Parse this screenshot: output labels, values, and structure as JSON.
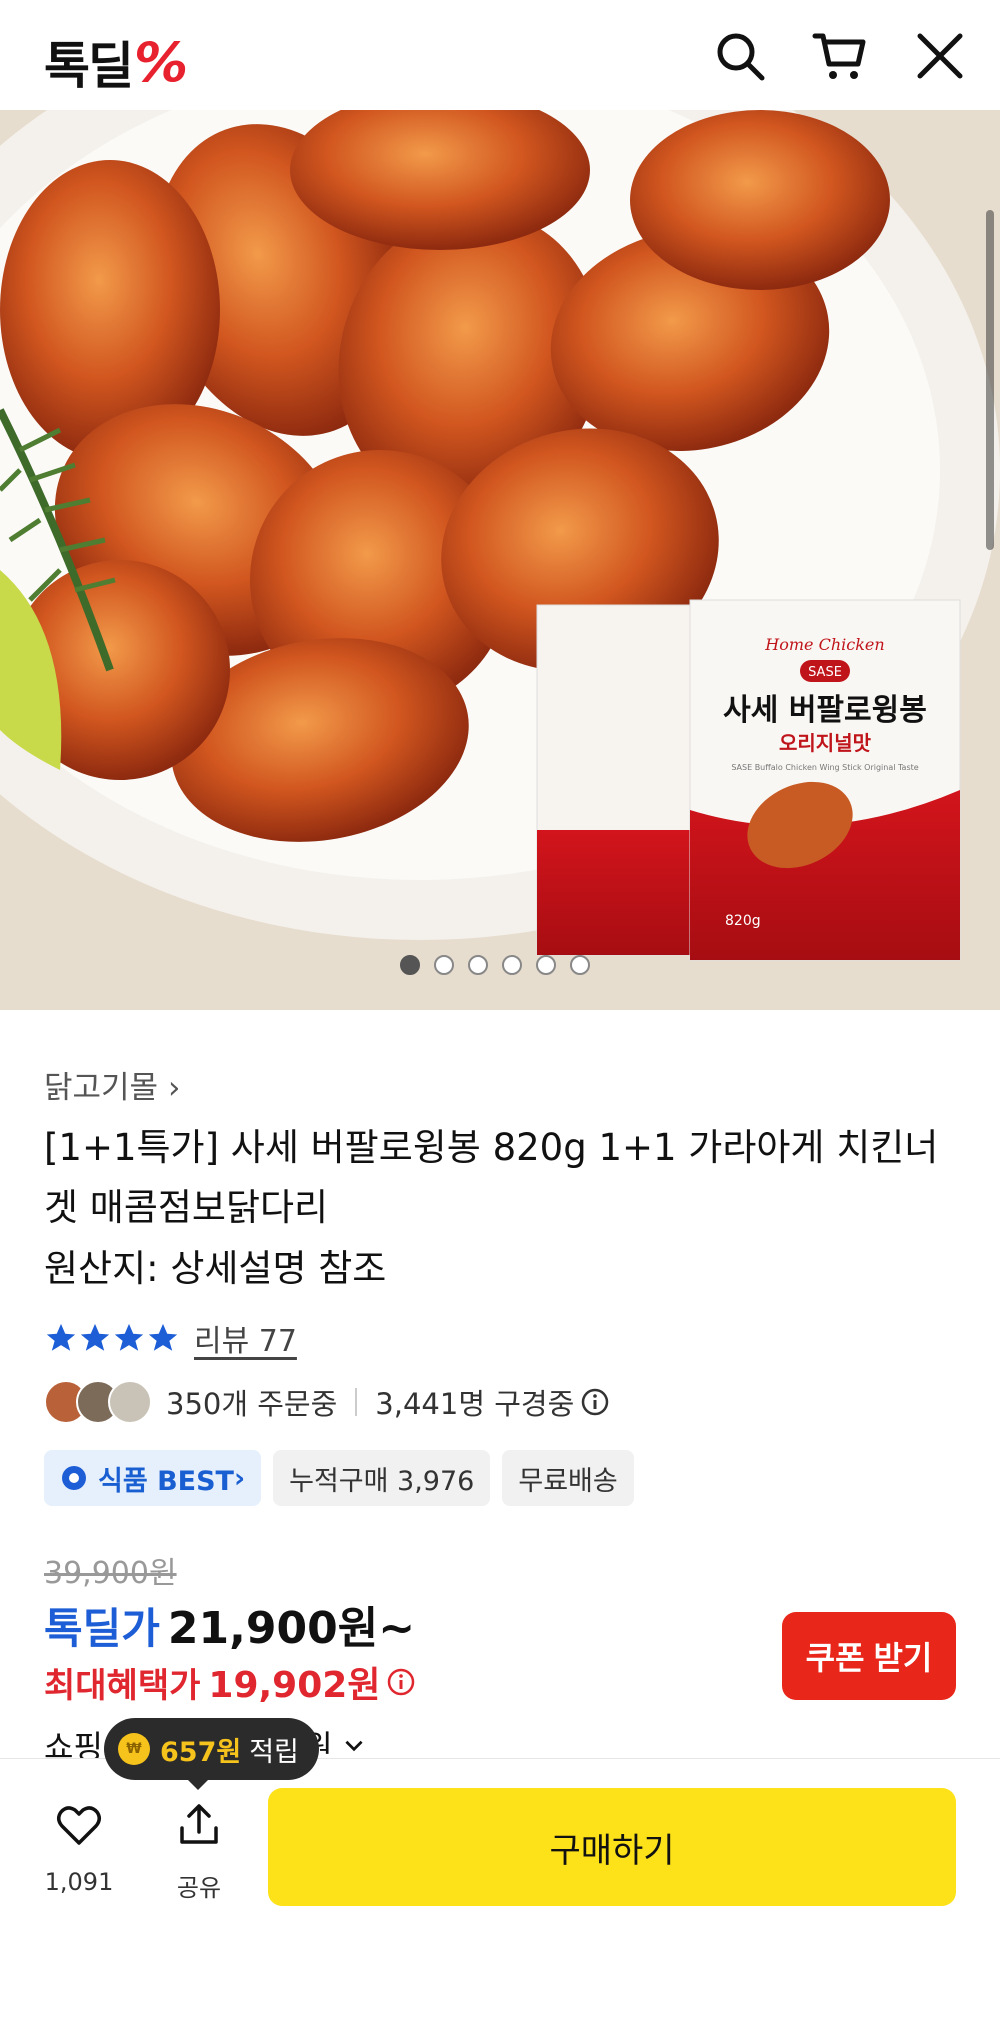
{
  "header": {
    "logo_text": "톡딜",
    "logo_mark": "%",
    "icons": [
      "search-icon",
      "cart-icon",
      "close-icon"
    ]
  },
  "hero": {
    "package_brand": "Home Chicken",
    "package_badge": "SASE",
    "package_title": "사세 버팔로윙봉",
    "package_subtitle": "오리지널맛",
    "package_english": "SASE Buffalo Chicken Wing Stick Original Taste",
    "package_weight": "820g",
    "carousel_total": 6,
    "carousel_active": 1
  },
  "product": {
    "breadcrumb": "닭고기몰",
    "title": "[1+1특가] 사세 버팔로윙봉 820g 1+1 가라아게 치킨너겟 매콤점보닭다리",
    "origin": "원산지: 상세설명 참조",
    "rating_stars": 4,
    "review_label": "리뷰 77",
    "ordering": "350개 주문중",
    "watching": "3,441명 구경중"
  },
  "tags": {
    "best": "식품 BEST",
    "cumulative": "누적구매 3,976",
    "shipping": "무료배송"
  },
  "pricing": {
    "original": "39,900원",
    "deal_label": "톡딜가",
    "deal_price": "21,900원~",
    "max_benefit_label": "최대혜택가",
    "max_benefit_price": "19,902원",
    "coupon_button": "쿠폰 받기",
    "shopping_prefix": "쇼핑",
    "shopping_suffix": "0원"
  },
  "tooltip": {
    "amount": "657원",
    "label": "적립"
  },
  "bottom": {
    "like_count": "1,091",
    "share_label": "공유",
    "buy_button": "구매하기"
  },
  "colors": {
    "brand_red": "#e8212e",
    "deal_blue": "#1d5ed6",
    "buy_yellow": "#fde21a",
    "coupon_red": "#e8261a"
  }
}
